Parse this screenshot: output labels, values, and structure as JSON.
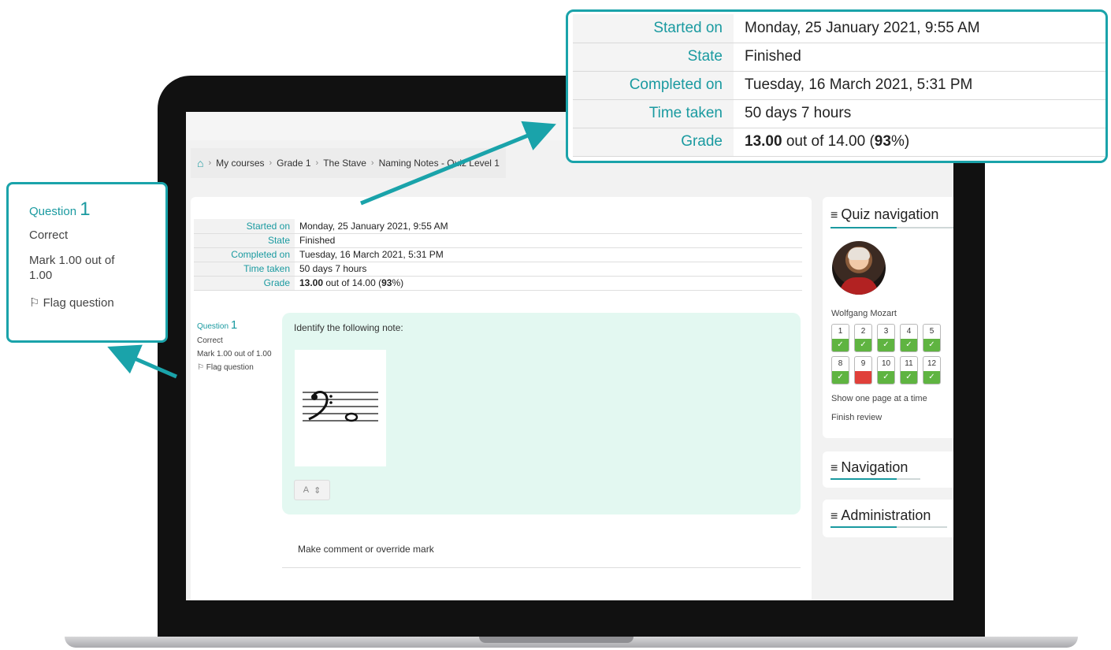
{
  "breadcrumb": {
    "items": [
      "My courses",
      "Grade 1",
      "The Stave",
      "Naming Notes - Quiz Level 1"
    ]
  },
  "summary": {
    "rows": [
      {
        "label": "Started on",
        "value": "Monday, 25 January 2021, 9:55 AM"
      },
      {
        "label": "State",
        "value": "Finished"
      },
      {
        "label": "Completed on",
        "value": "Tuesday, 16 March 2021, 5:31 PM"
      },
      {
        "label": "Time taken",
        "value": "50 days 7 hours"
      }
    ],
    "grade": {
      "label": "Grade",
      "score": "13.00",
      "middle": " out of 14.00 (",
      "percent": "93",
      "suffix": "%)"
    }
  },
  "question": {
    "label": "Question",
    "number": "1",
    "status": "Correct",
    "mark": "Mark 1.00 out of 1.00",
    "mark_line1": "Mark 1.00 out of",
    "mark_line2": "1.00",
    "flag": "Flag question",
    "prompt": "Identify the following note:",
    "answer": "A",
    "comment_link": "Make comment or override mark"
  },
  "quiz_nav": {
    "title": "Quiz navigation",
    "user": "Wolfgang Mozart",
    "buttons": [
      {
        "n": "1",
        "state": "correct"
      },
      {
        "n": "2",
        "state": "correct"
      },
      {
        "n": "3",
        "state": "correct"
      },
      {
        "n": "4",
        "state": "correct"
      },
      {
        "n": "5",
        "state": "correct"
      },
      {
        "n": "8",
        "state": "correct"
      },
      {
        "n": "9",
        "state": "incorrect"
      },
      {
        "n": "10",
        "state": "correct"
      },
      {
        "n": "11",
        "state": "correct"
      },
      {
        "n": "12",
        "state": "correct"
      }
    ],
    "show_one_page": "Show one page at a time",
    "finish_review": "Finish review"
  },
  "navigation": {
    "title": "Navigation"
  },
  "administration": {
    "title": "Administration"
  },
  "icons": {
    "home": "home-icon",
    "flag": "flag-icon",
    "menu": "hamburger-icon",
    "check": "check-icon",
    "select": "select-arrows-icon"
  },
  "colors": {
    "accent": "#1aa3aa",
    "correct_bg": "#e3f8f1",
    "correct": "#5fb441",
    "incorrect": "#e0403a"
  }
}
